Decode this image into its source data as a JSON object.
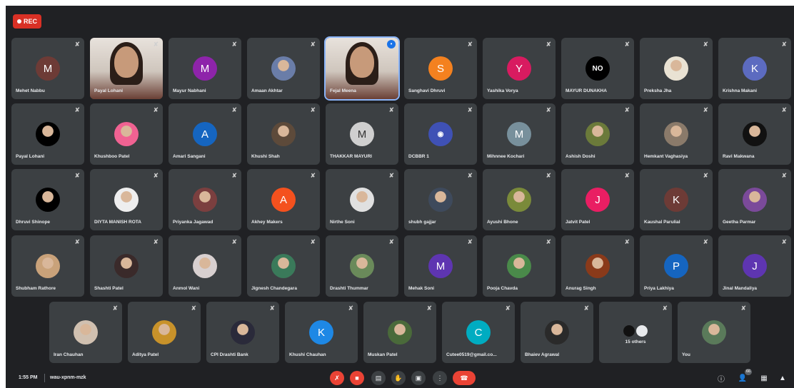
{
  "recording_badge": "REC",
  "rows": [
    [
      {
        "name": "Mehet Nabbu",
        "initial": "M",
        "color": "#6d3b36"
      },
      {
        "name": "Payal Lohani",
        "video": true
      },
      {
        "name": "Mayur Nabhani",
        "initial": "M",
        "color": "#8e24aa"
      },
      {
        "name": "Amaan Akhtar",
        "photo": true,
        "color": "#6a7da8"
      },
      {
        "name": "Fejal Meena",
        "video": true,
        "active": true
      },
      {
        "name": "Sanghavi Dhruvi",
        "initial": "S",
        "color": "#f4811f"
      },
      {
        "name": "Yashika Vorya",
        "initial": "Y",
        "color": "#d81b60"
      },
      {
        "name": "MAYUR DUNAKHA",
        "photo": true,
        "color": "#000000",
        "logo": "NO"
      },
      {
        "name": "Preksha Jha",
        "photo": true,
        "color": "#e9e2d3"
      },
      {
        "name": "Krishna Makani",
        "initial": "K",
        "color": "#5c6bc0"
      }
    ],
    [
      {
        "name": "Payal Lohani",
        "photo": true,
        "color": "#000000"
      },
      {
        "name": "Khushboo Patel",
        "photo": true,
        "color": "#f06292"
      },
      {
        "name": "Amari Sangani",
        "initial": "A",
        "color": "#1565c0"
      },
      {
        "name": "Khushi Shah",
        "photo": true,
        "color": "#5d4a3a"
      },
      {
        "name": "THAKKAR MAYURI",
        "initial": "M",
        "color": "#cfcfcf",
        "textColor": "#333"
      },
      {
        "name": "DCBBR 1",
        "photo": true,
        "color": "#3f51b5",
        "logo": "◉"
      },
      {
        "name": "Mihnnee Kochari",
        "initial": "M",
        "color": "#78909c"
      },
      {
        "name": "Ashish Doshi",
        "photo": true,
        "color": "#6b7a3a"
      },
      {
        "name": "Hemkant Vaghasiya",
        "photo": true,
        "color": "#8a7a6a"
      },
      {
        "name": "Ravi Makwana",
        "photo": true,
        "color": "#111111"
      }
    ],
    [
      {
        "name": "Dhruvi Shinope",
        "photo": true,
        "color": "#000000"
      },
      {
        "name": "DIYTA MANISH ROTA",
        "photo": true,
        "color": "#eeeeee"
      },
      {
        "name": "Priyanka Jagawad",
        "photo": true,
        "color": "#7b3f3f"
      },
      {
        "name": "Akhey Makers",
        "initial": "A",
        "color": "#f4511e"
      },
      {
        "name": "Nirthe Soni",
        "photo": true,
        "color": "#e0e0e0"
      },
      {
        "name": "shubh gajjar",
        "photo": true,
        "color": "#3e4a5c"
      },
      {
        "name": "Ayushi Bhone",
        "photo": true,
        "color": "#7a8a3a"
      },
      {
        "name": "Jatvit Patel",
        "initial": "J",
        "color": "#e91e63"
      },
      {
        "name": "Kaushal Parulial",
        "initial": "K",
        "color": "#6d3b36"
      },
      {
        "name": "Geetha Parmar",
        "photo": true,
        "color": "#7b4a9a"
      }
    ],
    [
      {
        "name": "Shubham Rathore",
        "photo": true,
        "color": "#c9a27a"
      },
      {
        "name": "Shashti Patel",
        "photo": true,
        "color": "#3a2a2a"
      },
      {
        "name": "Anmol Wani",
        "photo": true,
        "color": "#d8d0d0"
      },
      {
        "name": "Jignesh Chandegara",
        "photo": true,
        "color": "#3a7a5a"
      },
      {
        "name": "Drashti Thummar",
        "photo": true,
        "color": "#6a8a5a"
      },
      {
        "name": "Mehak Soni",
        "initial": "M",
        "color": "#5e35b1"
      },
      {
        "name": "Pooja Chavda",
        "photo": true,
        "color": "#4a8a4a"
      },
      {
        "name": "Anurag Singh",
        "photo": true,
        "color": "#8a3a1a"
      },
      {
        "name": "Priya Lakhiya",
        "initial": "P",
        "color": "#1565c0"
      },
      {
        "name": "Jinal Mandaliya",
        "initial": "J",
        "color": "#5e35b1"
      }
    ],
    [
      {
        "name": "Iran Chauhan",
        "photo": true,
        "color": "#d0c0b0"
      },
      {
        "name": "Aditya Patel",
        "photo": true,
        "color": "#c8922a"
      },
      {
        "name": "CPI Drashti Bank",
        "photo": true,
        "color": "#2a2a3a"
      },
      {
        "name": "Khushi Chauhan",
        "initial": "K",
        "color": "#1e88e5"
      },
      {
        "name": "Muskan Patel",
        "photo": true,
        "color": "#4a6a3a"
      },
      {
        "name": "Cutee0519@gmail.co...",
        "initial": "C",
        "color": "#00acc1"
      },
      {
        "name": "Bhaiev Agrawal",
        "photo": true,
        "color": "#2a2a2a"
      },
      {
        "name": "15 others",
        "others": true
      },
      {
        "name": "You",
        "photo": true,
        "color": "#5a7a5a"
      }
    ]
  ],
  "bottom_bar": {
    "time": "1:55 PM",
    "meeting_code": "wau-xpnm-mzk",
    "participant_count": "66"
  },
  "controls": [
    {
      "name": "mic-toggle-button",
      "icon": "mic-off-icon",
      "glyph": "✗",
      "red": true
    },
    {
      "name": "camera-toggle-button",
      "icon": "camera-off-icon",
      "glyph": "■",
      "red": true
    },
    {
      "name": "captions-button",
      "icon": "captions-icon",
      "glyph": "▤"
    },
    {
      "name": "raise-hand-button",
      "icon": "hand-icon",
      "glyph": "✋"
    },
    {
      "name": "present-button",
      "icon": "present-icon",
      "glyph": "▣"
    },
    {
      "name": "more-options-button",
      "icon": "more-vert-icon",
      "glyph": "⋮"
    },
    {
      "name": "leave-call-button",
      "icon": "phone-hangup-icon",
      "glyph": "☎",
      "hangup": true
    }
  ]
}
